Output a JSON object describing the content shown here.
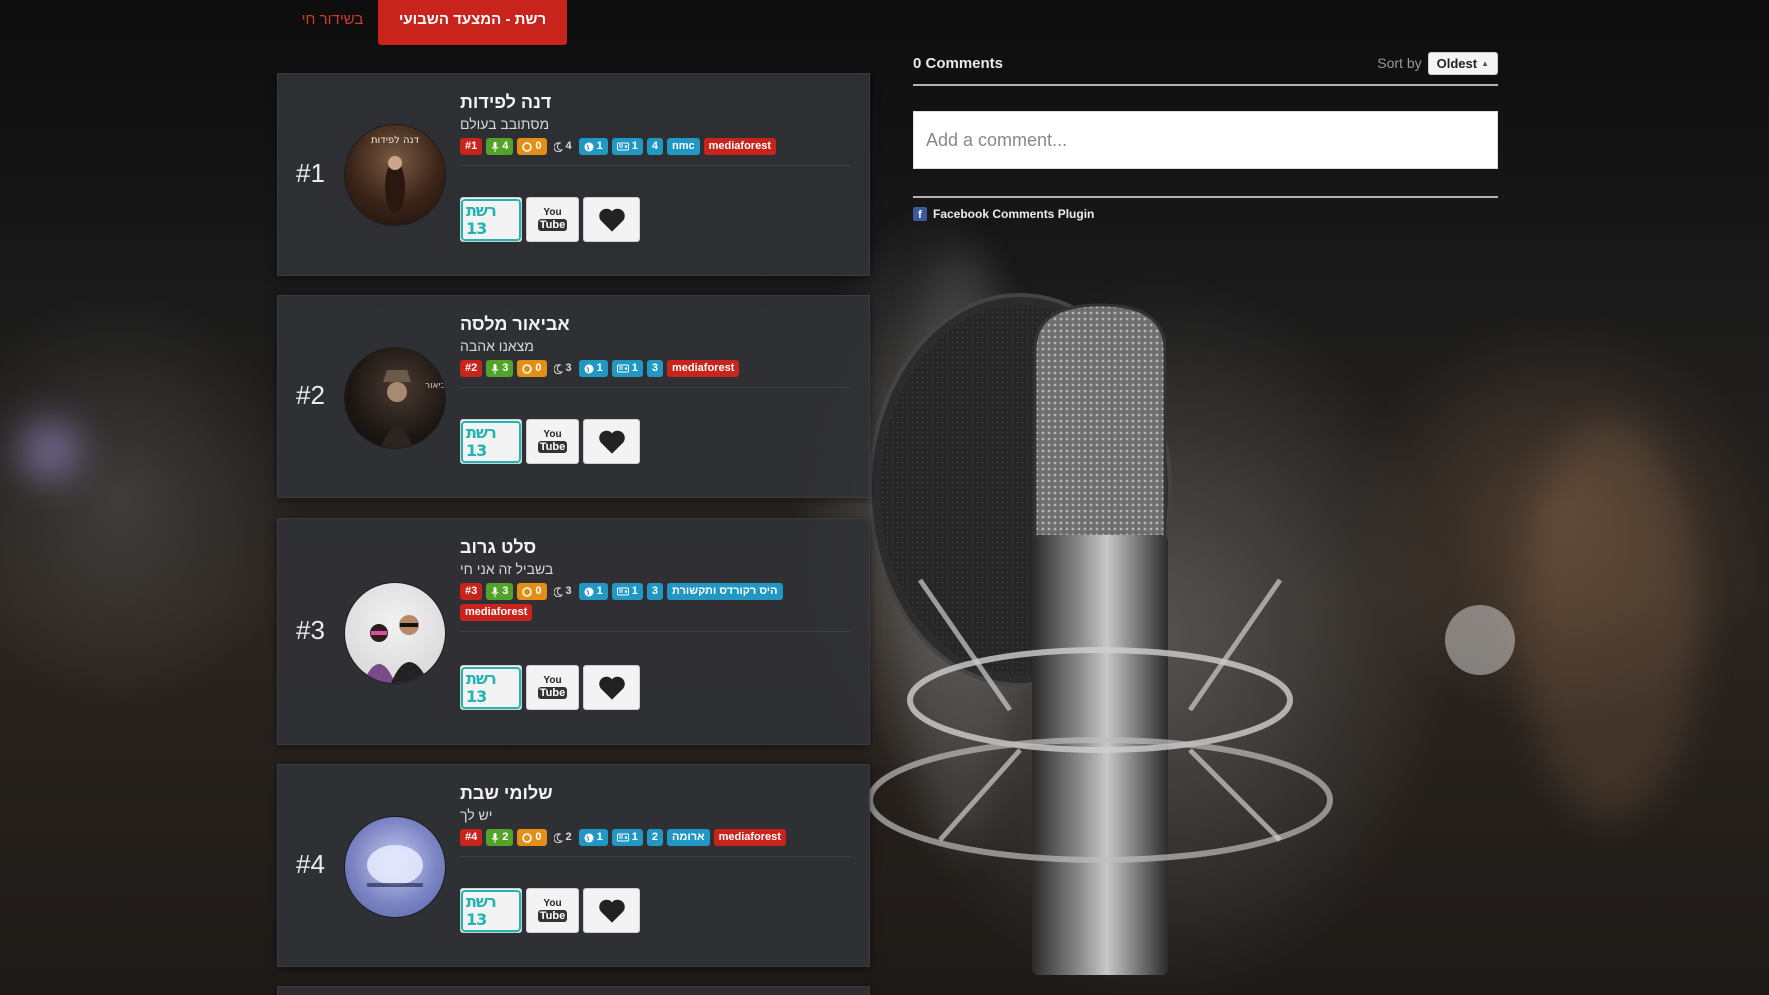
{
  "tabs": {
    "active": "רשת - המצעד השבועי",
    "live": "בשידור חי"
  },
  "entries": [
    {
      "rank": "#1",
      "artist": "דנה לפידות",
      "song": "מסתובב בעולם",
      "badges": [
        {
          "text": "#1",
          "color": "red",
          "icon": ""
        },
        {
          "text": "4",
          "color": "green",
          "icon": "mic-icon"
        },
        {
          "text": "0",
          "color": "orange",
          "icon": "record-icon"
        },
        {
          "text": "4",
          "color": "plain",
          "icon": "moon-icon"
        },
        {
          "text": "1",
          "color": "blue",
          "icon": "globe-icon"
        },
        {
          "text": "1",
          "color": "blue",
          "icon": "radio-icon"
        },
        {
          "text": "4",
          "color": "blue",
          "icon": ""
        },
        {
          "text": "nmc",
          "color": "blue",
          "icon": ""
        },
        {
          "text": "mediaforest",
          "color": "red",
          "icon": ""
        }
      ]
    },
    {
      "rank": "#2",
      "artist": "אביאור מלסה",
      "song": "מצאנו אהבה",
      "badges": [
        {
          "text": "#2",
          "color": "red",
          "icon": ""
        },
        {
          "text": "3",
          "color": "green",
          "icon": "mic-icon"
        },
        {
          "text": "0",
          "color": "orange",
          "icon": "record-icon"
        },
        {
          "text": "3",
          "color": "plain",
          "icon": "moon-icon"
        },
        {
          "text": "1",
          "color": "blue",
          "icon": "globe-icon"
        },
        {
          "text": "1",
          "color": "blue",
          "icon": "radio-icon"
        },
        {
          "text": "3",
          "color": "blue",
          "icon": ""
        },
        {
          "text": "mediaforest",
          "color": "red",
          "icon": ""
        }
      ]
    },
    {
      "rank": "#3",
      "artist": "סלט גרוב",
      "song": "בשביל זה אני חי",
      "badges": [
        {
          "text": "#3",
          "color": "red",
          "icon": ""
        },
        {
          "text": "3",
          "color": "green",
          "icon": "mic-icon"
        },
        {
          "text": "0",
          "color": "orange",
          "icon": "record-icon"
        },
        {
          "text": "3",
          "color": "plain",
          "icon": "moon-icon"
        },
        {
          "text": "1",
          "color": "blue",
          "icon": "globe-icon"
        },
        {
          "text": "1",
          "color": "blue",
          "icon": "radio-icon"
        },
        {
          "text": "3",
          "color": "blue",
          "icon": ""
        },
        {
          "text": "היס רקורדס ותקשורת",
          "color": "blue",
          "icon": ""
        },
        {
          "text": "mediaforest",
          "color": "red",
          "icon": ""
        }
      ]
    },
    {
      "rank": "#4",
      "artist": "שלומי שבת",
      "song": "יש לך",
      "badges": [
        {
          "text": "#4",
          "color": "red",
          "icon": ""
        },
        {
          "text": "2",
          "color": "green",
          "icon": "mic-icon"
        },
        {
          "text": "0",
          "color": "orange",
          "icon": "record-icon"
        },
        {
          "text": "2",
          "color": "plain",
          "icon": "moon-icon"
        },
        {
          "text": "1",
          "color": "blue",
          "icon": "globe-icon"
        },
        {
          "text": "1",
          "color": "blue",
          "icon": "radio-icon"
        },
        {
          "text": "2",
          "color": "blue",
          "icon": ""
        },
        {
          "text": "ארומה",
          "color": "blue",
          "icon": ""
        },
        {
          "text": "mediaforest",
          "color": "red",
          "icon": ""
        }
      ]
    }
  ],
  "actions": {
    "reshet_label": "רשת 13",
    "youtube_you": "You",
    "youtube_tube": "Tube"
  },
  "comments": {
    "count": "0 Comments",
    "sort_label": "Sort by",
    "sort_value": "Oldest",
    "placeholder": "Add a comment...",
    "plugin": "Facebook Comments Plugin"
  },
  "colors": {
    "red": "#c9241b",
    "green": "#53a32a",
    "orange": "#e38f17",
    "blue": "#2197c4"
  }
}
